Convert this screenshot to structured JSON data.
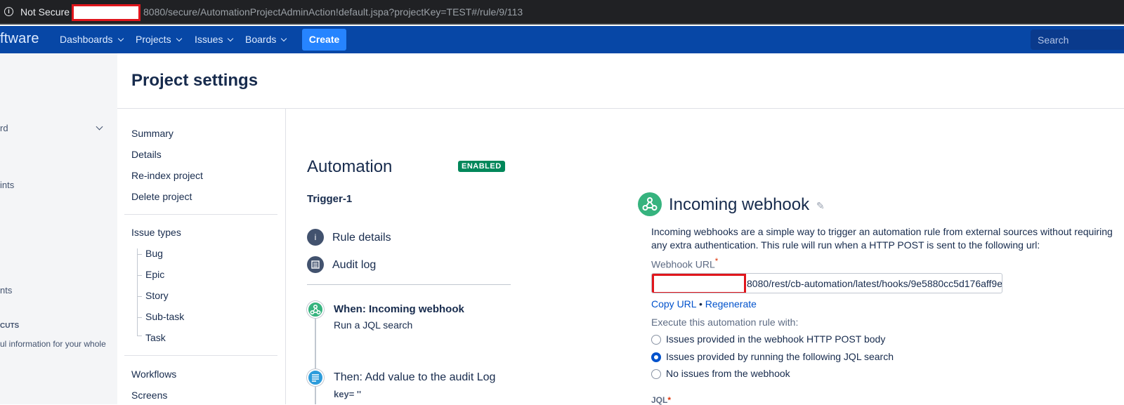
{
  "browser": {
    "security_label": "Not Secure",
    "url": "8080/secure/AutomationProjectAdminAction!default.jspa?projectKey=TEST#/rule/9/113"
  },
  "topnav": {
    "logo_text": "ftware",
    "items": [
      "Dashboards",
      "Projects",
      "Issues",
      "Boards"
    ],
    "create_label": "Create",
    "search_placeholder": "Search"
  },
  "leftbar": {
    "fragments": [
      "rd",
      "ints",
      "nts",
      "CUTS",
      "ul information for your whole"
    ]
  },
  "page_title": "Project settings",
  "settings_nav": {
    "general": [
      "Summary",
      "Details",
      "Re-index project",
      "Delete project"
    ],
    "issue_types_label": "Issue types",
    "issue_types": [
      "Bug",
      "Epic",
      "Story",
      "Sub-task",
      "Task"
    ],
    "other": [
      "Workflows",
      "Screens"
    ]
  },
  "automation": {
    "title": "Automation",
    "status_badge": "ENABLED",
    "trigger_name": "Trigger-1",
    "rule_details": "Rule details",
    "audit_log": "Audit log",
    "steps": [
      {
        "title_bold": "When: Incoming webhook",
        "subtitle": "Run a JQL search"
      },
      {
        "title": "Then: Add value to the audit Log",
        "subtitle": "key= ''"
      }
    ]
  },
  "webhook": {
    "title": "Incoming webhook",
    "description": "Incoming webhooks are a simple way to trigger an automation rule from external sources without requiring any extra authentication. This rule will run when a HTTP POST is sent to the following url:",
    "url_label": "Webhook URL",
    "url_value": "8080/rest/cb-automation/latest/hooks/9e5880cc5d176aff9e",
    "copy_url": "Copy URL",
    "separator": "•",
    "regenerate": "Regenerate",
    "execute_label": "Execute this automation rule with:",
    "options": [
      "Issues provided in the webhook HTTP POST body",
      "Issues provided by running the following JQL search",
      "No issues from the webhook"
    ],
    "selected_option": 1,
    "jql_label": "JQL",
    "required_mark": "*"
  },
  "colors": {
    "nav_bg": "#0747a6",
    "create_btn": "#2684ff",
    "badge_green": "#00875a",
    "webhook_green": "#36b37e",
    "link_blue": "#0052cc",
    "redaction": "#e0161c"
  }
}
